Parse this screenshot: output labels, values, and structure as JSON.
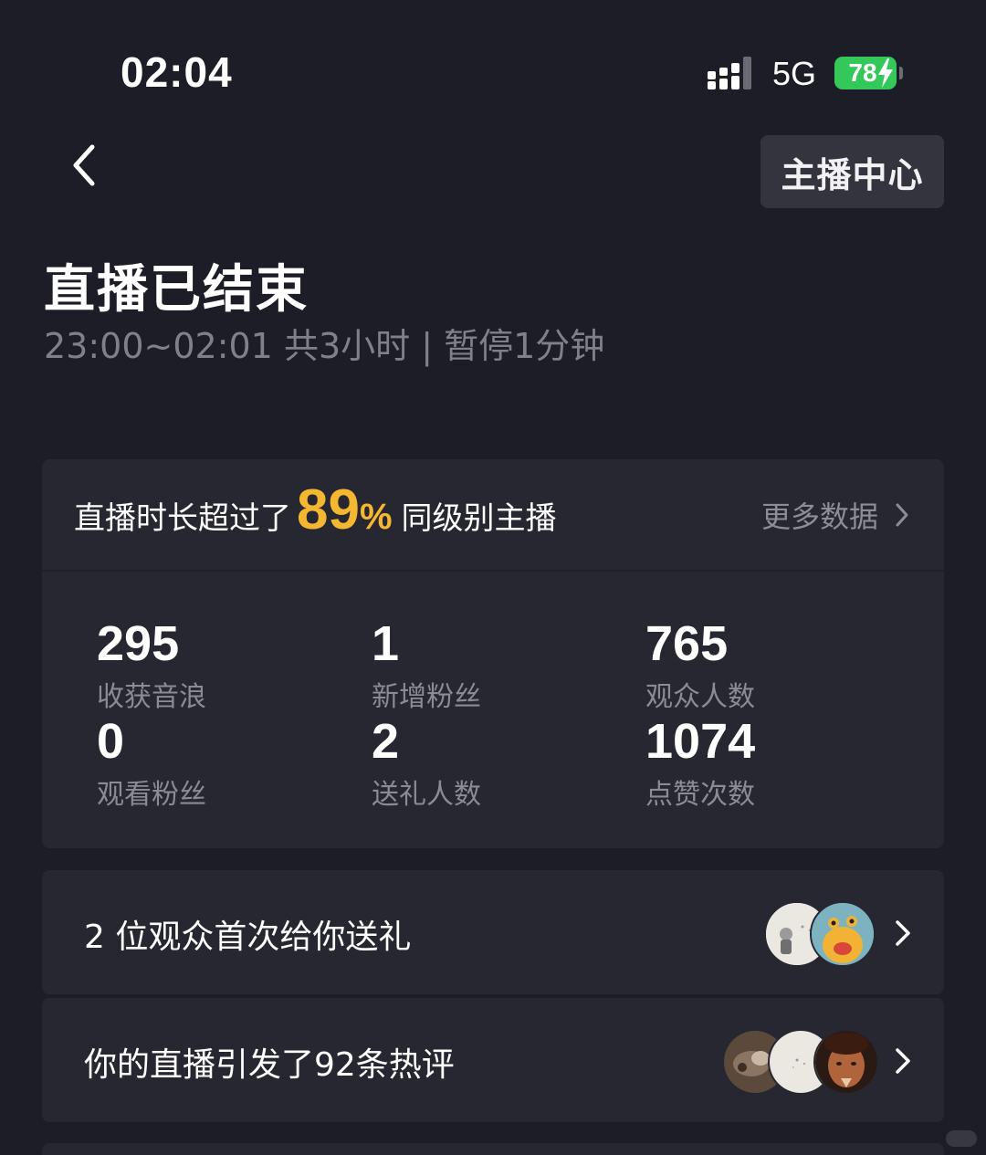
{
  "status_bar": {
    "time": "02:04",
    "network": "5G",
    "battery": "78",
    "colors": {
      "battery": "#34c759"
    },
    "icons": [
      "signal-icon",
      "bolt-icon"
    ]
  },
  "nav": {
    "back_icon": "chevron-left-icon",
    "anchor_center_label": "主播中心"
  },
  "header": {
    "title": "直播已结束",
    "subtitle": "23:00~02:01 共3小时 | 暂停1分钟"
  },
  "stats": {
    "rank_prefix": "直播时长超过了",
    "rank_value": "89",
    "rank_unit": "%",
    "rank_suffix": "同级别主播",
    "more_data_label": "更多数据",
    "accent_color": "#f5b731",
    "metrics": [
      {
        "value": "295",
        "label": "收获音浪"
      },
      {
        "value": "1",
        "label": "新增粉丝"
      },
      {
        "value": "765",
        "label": "观众人数"
      },
      {
        "value": "0",
        "label": "观看粉丝"
      },
      {
        "value": "2",
        "label": "送礼人数"
      },
      {
        "value": "1074",
        "label": "点赞次数"
      }
    ]
  },
  "rows": [
    {
      "label": "2 位观众首次给你送礼",
      "avatars": [
        "avatar-photo",
        "avatar-monster"
      ]
    },
    {
      "label": "你的直播引发了92条热评",
      "avatars": [
        "avatar-photo",
        "avatar-photo",
        "avatar-character"
      ]
    }
  ]
}
